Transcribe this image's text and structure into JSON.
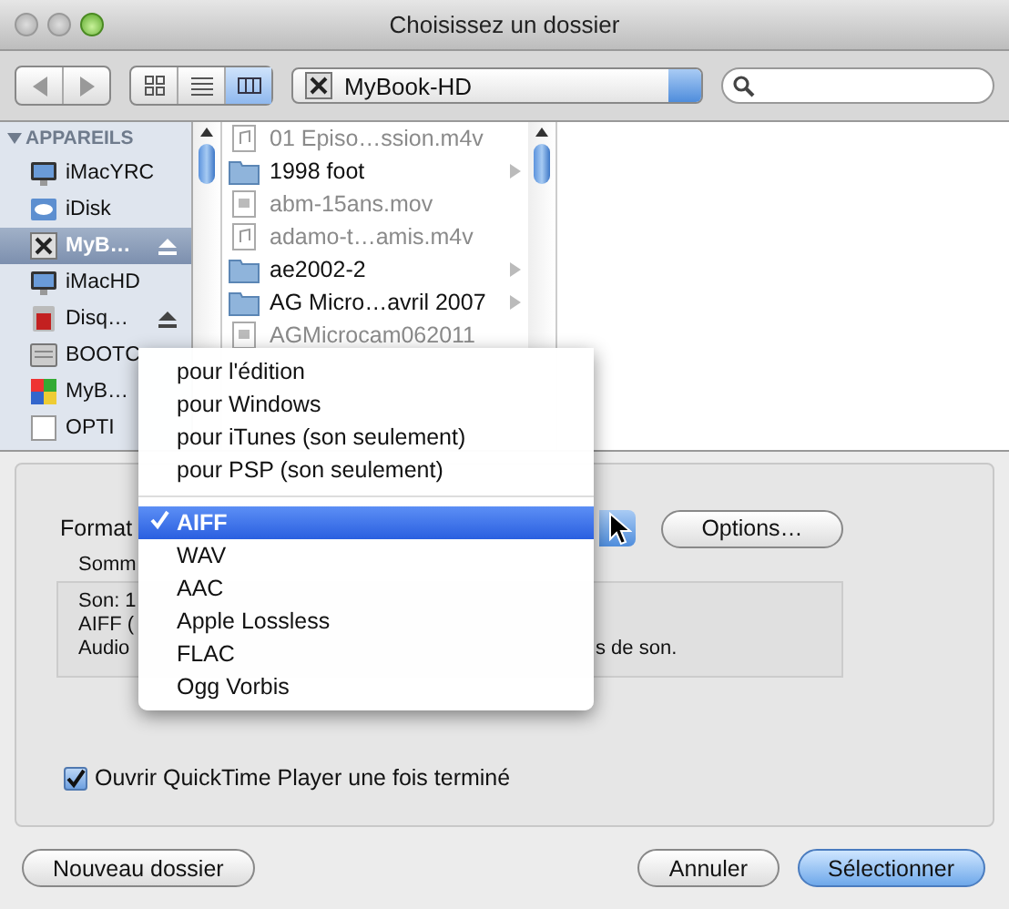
{
  "window": {
    "title": "Choisissez un dossier"
  },
  "toolbar": {
    "location": "MyBook-HD",
    "views": [
      {
        "kind": "icons",
        "selected": false
      },
      {
        "kind": "list",
        "selected": false
      },
      {
        "kind": "columns",
        "selected": true
      }
    ]
  },
  "sidebar": {
    "header": "APPAREILS",
    "expanded": true,
    "items": [
      {
        "label": "iMacYRC",
        "kind": "computer",
        "selected": false,
        "eject": false
      },
      {
        "label": "iDisk",
        "kind": "idisk",
        "selected": false,
        "eject": false
      },
      {
        "label": "MyB…",
        "kind": "disk",
        "selected": true,
        "eject": true
      },
      {
        "label": "iMacHD",
        "kind": "computer",
        "selected": false,
        "eject": false
      },
      {
        "label": "Disq…",
        "kind": "redisk",
        "selected": false,
        "eject": true
      },
      {
        "label": "BOOTC",
        "kind": "drive",
        "selected": false,
        "eject": false
      },
      {
        "label": "MyB…",
        "kind": "colordisk",
        "selected": false,
        "eject": false
      },
      {
        "label": "OPTI",
        "kind": "blank",
        "selected": false,
        "eject": false
      }
    ]
  },
  "files": [
    {
      "name": "01 Episo…ssion.m4v",
      "kind": "music",
      "disabled": true
    },
    {
      "name": "1998 foot",
      "kind": "folder",
      "disabled": false
    },
    {
      "name": "abm-15ans.mov",
      "kind": "movie",
      "disabled": true
    },
    {
      "name": "adamo-t…amis.m4v",
      "kind": "music",
      "disabled": true
    },
    {
      "name": "ae2002-2",
      "kind": "folder",
      "disabled": false
    },
    {
      "name": "AG Micro…avril 2007",
      "kind": "folder",
      "disabled": false
    },
    {
      "name": "AGMicrocam062011",
      "kind": "movie",
      "disabled": true
    }
  ],
  "format": {
    "label": "Format",
    "options_button": "Options…"
  },
  "summary": {
    "label": "Somm",
    "lines": [
      {
        "start": "Son: 1"
      },
      {
        "start": "AIFF ("
      },
      {
        "start": "Audio",
        "end": "s de son."
      }
    ]
  },
  "menu": {
    "groups": [
      {
        "items": [
          {
            "label": "pour l'édition",
            "selected": false
          },
          {
            "label": "pour Windows",
            "selected": false
          },
          {
            "label": "pour iTunes (son seulement)",
            "selected": false
          },
          {
            "label": "pour PSP (son seulement)",
            "selected": false
          }
        ]
      },
      {
        "items": [
          {
            "label": "AIFF",
            "selected": true
          },
          {
            "label": "WAV",
            "selected": false
          },
          {
            "label": "AAC",
            "selected": false
          },
          {
            "label": "Apple Lossless",
            "selected": false
          },
          {
            "label": "FLAC",
            "selected": false
          },
          {
            "label": "Ogg Vorbis",
            "selected": false
          }
        ]
      }
    ]
  },
  "checkbox": {
    "label": "Ouvrir QuickTime Player une fois terminé",
    "checked": true
  },
  "buttons": [
    {
      "label": "Nouveau dossier",
      "kind": "secondary"
    },
    {
      "label": "Annuler",
      "kind": "normal"
    },
    {
      "label": "Sélectionner",
      "kind": "default"
    }
  ]
}
